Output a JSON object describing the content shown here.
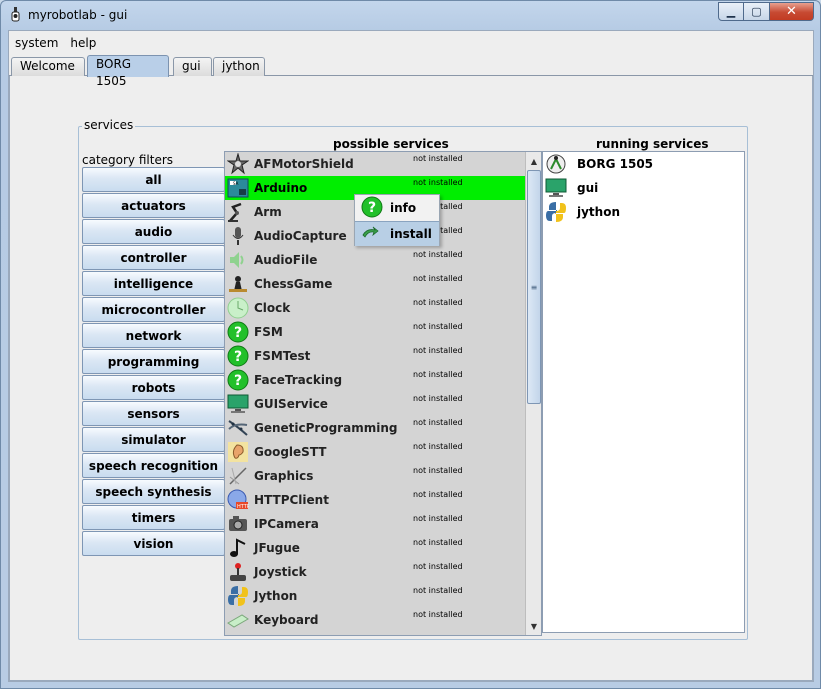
{
  "window": {
    "title": "myrobotlab - gui"
  },
  "menu": [
    "system",
    "help"
  ],
  "tabs": [
    {
      "label": "Welcome",
      "selected": false
    },
    {
      "label": "BORG 1505",
      "selected": true
    },
    {
      "label": "gui",
      "selected": false
    },
    {
      "label": "jython",
      "selected": false
    }
  ],
  "services_panel": {
    "title": "services",
    "category_label": "category filters",
    "categories": [
      "all",
      "actuators",
      "audio",
      "controller",
      "intelligence",
      "microcontroller",
      "network",
      "programming",
      "robots",
      "sensors",
      "simulator",
      "speech recognition",
      "speech synthesis",
      "timers",
      "vision"
    ],
    "possible_title": "possible services",
    "running_title": "running services",
    "possible": [
      {
        "name": "AFMotorShield",
        "status": "not installed",
        "icon": "motor-shield-icon",
        "selected": false
      },
      {
        "name": "Arduino",
        "status": "not installed",
        "icon": "arduino-icon",
        "selected": true
      },
      {
        "name": "Arm",
        "status": "not installed",
        "icon": "robot-arm-icon",
        "selected": false
      },
      {
        "name": "AudioCapture",
        "status": "not installed",
        "icon": "microphone-icon",
        "selected": false
      },
      {
        "name": "AudioFile",
        "status": "not installed",
        "icon": "speaker-icon",
        "selected": false
      },
      {
        "name": "ChessGame",
        "status": "not installed",
        "icon": "chess-icon",
        "selected": false
      },
      {
        "name": "Clock",
        "status": "not installed",
        "icon": "clock-icon",
        "selected": false
      },
      {
        "name": "FSM",
        "status": "not installed",
        "icon": "help-icon",
        "selected": false
      },
      {
        "name": "FSMTest",
        "status": "not installed",
        "icon": "help-icon",
        "selected": false
      },
      {
        "name": "FaceTracking",
        "status": "not installed",
        "icon": "help-icon",
        "selected": false
      },
      {
        "name": "GUIService",
        "status": "not installed",
        "icon": "monitor-icon",
        "selected": false
      },
      {
        "name": "GeneticProgramming",
        "status": "not installed",
        "icon": "dna-icon",
        "selected": false
      },
      {
        "name": "GoogleSTT",
        "status": "not installed",
        "icon": "ear-icon",
        "selected": false
      },
      {
        "name": "Graphics",
        "status": "not installed",
        "icon": "drawing-icon",
        "selected": false
      },
      {
        "name": "HTTPClient",
        "status": "not installed",
        "icon": "http-icon",
        "selected": false
      },
      {
        "name": "IPCamera",
        "status": "not installed",
        "icon": "camera-icon",
        "selected": false
      },
      {
        "name": "JFugue",
        "status": "not installed",
        "icon": "music-note-icon",
        "selected": false
      },
      {
        "name": "Joystick",
        "status": "not installed",
        "icon": "joystick-icon",
        "selected": false
      },
      {
        "name": "Jython",
        "status": "not installed",
        "icon": "python-icon",
        "selected": false
      },
      {
        "name": "Keyboard",
        "status": "not installed",
        "icon": "keyboard-icon",
        "selected": false
      }
    ],
    "running": [
      {
        "name": "BORG 1505",
        "icon": "runtime-icon"
      },
      {
        "name": "gui",
        "icon": "monitor-icon"
      },
      {
        "name": "jython",
        "icon": "python-icon"
      }
    ]
  },
  "context_menu": {
    "items": [
      {
        "label": "info",
        "icon": "help-icon",
        "highlighted": false
      },
      {
        "label": "install",
        "icon": "install-icon",
        "highlighted": true
      }
    ]
  },
  "colors": {
    "selected_row": "#00ee00",
    "help_icon": "#22c02a",
    "window_frame": "#b8cce4"
  }
}
